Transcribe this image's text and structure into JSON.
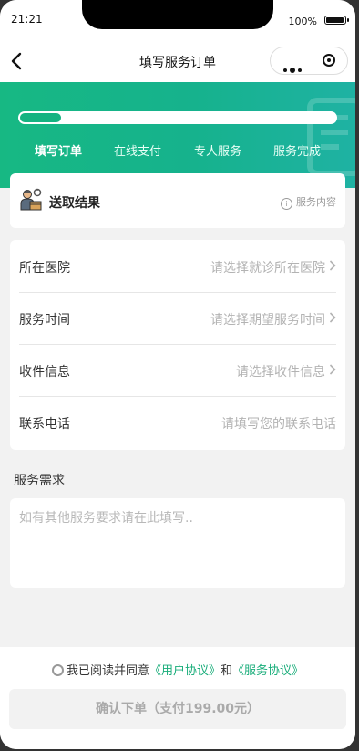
{
  "status_bar": {
    "time": "21:21",
    "battery_text": "100%",
    "battery_level": 1.0
  },
  "nav": {
    "title": "填写服务订单"
  },
  "progress": {
    "fraction": 0.13
  },
  "steps": [
    {
      "label": "填写订单",
      "active": true
    },
    {
      "label": "在线支付",
      "active": false
    },
    {
      "label": "专人服务",
      "active": false
    },
    {
      "label": "服务完成",
      "active": false
    }
  ],
  "service": {
    "name": "送取结果",
    "info_label": "服务内容"
  },
  "form": {
    "rows": [
      {
        "label": "所在医院",
        "placeholder": "请选择就诊所在医院"
      },
      {
        "label": "服务时间",
        "placeholder": "请选择期望服务时间"
      },
      {
        "label": "收件信息",
        "placeholder": "请选择收件信息"
      },
      {
        "label": "联系电话",
        "placeholder": "请填写您的联系电话"
      }
    ]
  },
  "requirements": {
    "label": "服务需求",
    "placeholder": "如有其他服务要求请在此填写.."
  },
  "agreement": {
    "prefix": "我已阅读并同意",
    "user_link": "《用户协议》",
    "joiner": "和",
    "service_link": "《服务协议》"
  },
  "confirm_label": "确认下单（支付199.00元）",
  "colors": {
    "brand_green": "#17b883",
    "link_green": "#19ad7a"
  }
}
